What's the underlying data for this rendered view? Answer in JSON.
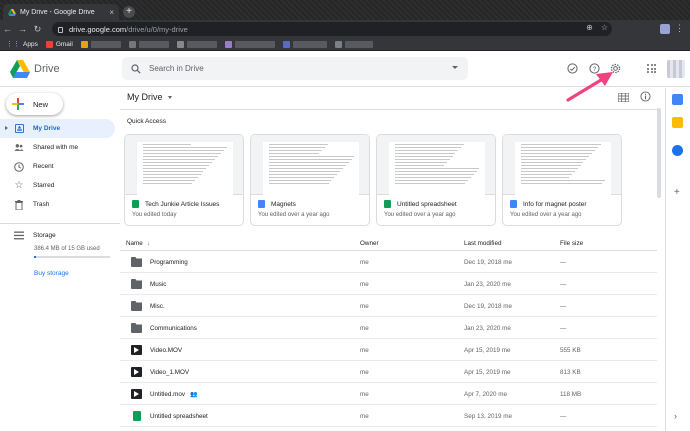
{
  "browser": {
    "tab_title": "My Drive - Google Drive",
    "tab_close": "×",
    "new_tab": "+",
    "url_host": "drive.google.com",
    "url_path": "/drive/u/0/my-drive",
    "bookmarks": [
      "Apps",
      "Gmail"
    ]
  },
  "header": {
    "brand": "Drive",
    "search_placeholder": "Search in Drive"
  },
  "sidebar": {
    "new_label": "New",
    "items": [
      {
        "label": "My Drive"
      },
      {
        "label": "Shared with me"
      },
      {
        "label": "Recent"
      },
      {
        "label": "Starred"
      },
      {
        "label": "Trash"
      }
    ],
    "storage_label": "Storage",
    "storage_used": "386.4 MB of 15 GB used",
    "storage_fraction": 0.026,
    "buy_storage": "Buy storage"
  },
  "main": {
    "title": "My Drive",
    "quick_access": "Quick Access",
    "cards": [
      {
        "name": "Tech Junkie Article Issues",
        "sub": "You edited today",
        "type": "sheet"
      },
      {
        "name": "Magnets",
        "sub": "You edited over a year ago",
        "type": "doc"
      },
      {
        "name": "Untitled spreadsheet",
        "sub": "You edited over a year ago",
        "type": "sheet"
      },
      {
        "name": "Info for magnet poster",
        "sub": "You edited over a year ago",
        "type": "doc"
      }
    ],
    "columns": {
      "name": "Name",
      "sort": "↓",
      "owner": "Owner",
      "modified": "Last modified",
      "size": "File size"
    },
    "files": [
      {
        "name": "Programming",
        "owner": "me",
        "modified": "Dec 19, 2018 me",
        "size": "—",
        "type": "folder"
      },
      {
        "name": "Music",
        "owner": "me",
        "modified": "Jan 23, 2020 me",
        "size": "—",
        "type": "folder"
      },
      {
        "name": "Misc.",
        "owner": "me",
        "modified": "Dec 19, 2018 me",
        "size": "—",
        "type": "folder"
      },
      {
        "name": "Communications",
        "owner": "me",
        "modified": "Jan 23, 2020 me",
        "size": "—",
        "type": "folder"
      },
      {
        "name": "Video.MOV",
        "owner": "me",
        "modified": "Apr 15, 2019 me",
        "size": "555 KB",
        "type": "video"
      },
      {
        "name": "Video_1.MOV",
        "owner": "me",
        "modified": "Apr 15, 2019 me",
        "size": "813 KB",
        "type": "video"
      },
      {
        "name": "Untitled.mov",
        "owner": "me",
        "modified": "Apr 7, 2020 me",
        "size": "118 MB",
        "type": "video",
        "shared": true
      },
      {
        "name": "Untitled spreadsheet",
        "owner": "me",
        "modified": "Sep 13, 2019 me",
        "size": "—",
        "type": "sheet"
      }
    ]
  },
  "colors": {
    "accent": "#1a73e8",
    "active_bg": "#e8f0fe",
    "annotation_arrow": "#f0427f",
    "sheet_green": "#0f9d58",
    "doc_blue": "#4285f4"
  }
}
